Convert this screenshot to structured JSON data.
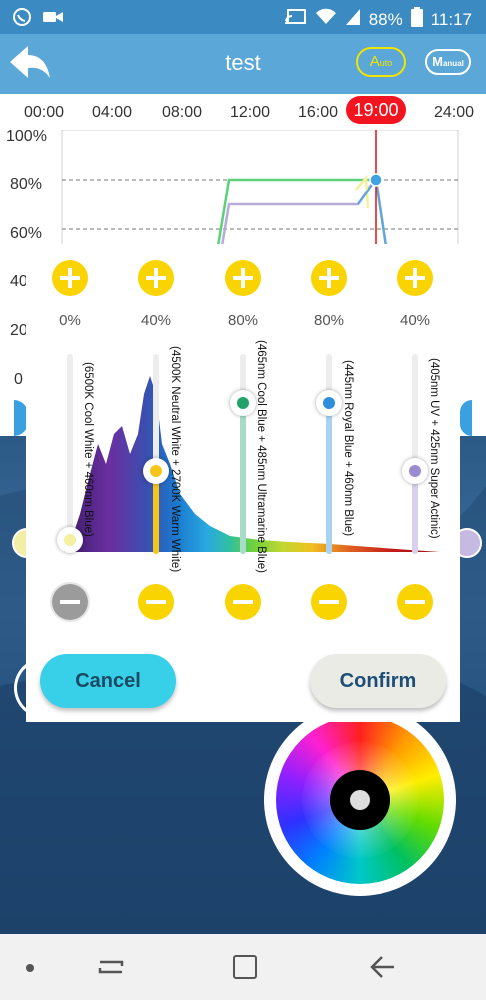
{
  "status_bar": {
    "battery": "88%",
    "time": "11:17"
  },
  "header": {
    "title": "test",
    "auto_label_big": "A",
    "auto_label_small": "uto",
    "manual_label_big": "M",
    "manual_label_small": "anual"
  },
  "timeline": {
    "ticks": [
      "00:00",
      "04:00",
      "08:00",
      "12:00",
      "16:00",
      "24:00"
    ],
    "current_time": "19:00",
    "y_labels": [
      "100%",
      "80%",
      "60%",
      "40",
      "20",
      "0"
    ]
  },
  "dialog": {
    "channels": [
      {
        "percent": "0%",
        "label": "(6500K Cool White + 460nm Blue)",
        "color": "#f4f0a0",
        "level": 0.0
      },
      {
        "percent": "40%",
        "label": "(4500K Neutral White + 2700K Warm White)",
        "color": "#f5c518",
        "level": 0.4
      },
      {
        "percent": "80%",
        "label": "(465nm Cool Blue + 485nm Ultramarine Blue)",
        "color": "#23a26a",
        "level": 0.8
      },
      {
        "percent": "80%",
        "label": "(445nm Royal Blue + 460nm Blue)",
        "color": "#2e8fdc",
        "level": 0.8
      },
      {
        "percent": "40%",
        "label": "(405nm UV + 425nm Super Actinic)",
        "color": "#9b8bd0",
        "level": 0.4
      }
    ],
    "cancel_label": "Cancel",
    "confirm_label": "Confirm"
  },
  "colors": {
    "accent_yellow": "#fad400",
    "header_blue": "#5aa7d8",
    "now_red": "#f2141e"
  }
}
